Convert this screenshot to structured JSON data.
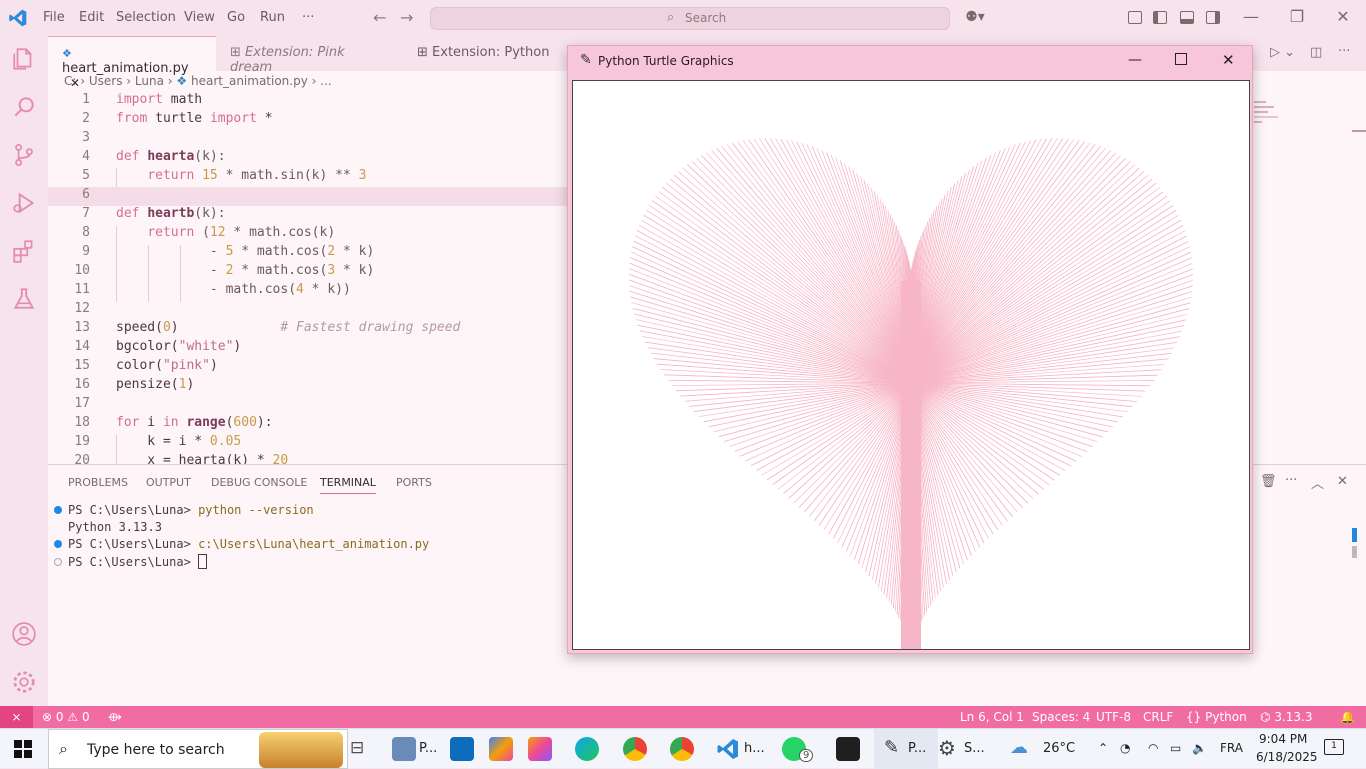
{
  "menu": [
    "File",
    "Edit",
    "Selection",
    "View",
    "Go",
    "Run",
    "···"
  ],
  "search": {
    "placeholder": "Search"
  },
  "tabs": [
    {
      "label": "heart_animation.py",
      "close": "✕"
    },
    {
      "label": "Extension: Pink dream"
    },
    {
      "label": "Extension: Python"
    }
  ],
  "breadcrumb": [
    "C:",
    "Users",
    "Luna",
    "heart_animation.py",
    "..."
  ],
  "code": [
    {
      "n": "1",
      "t": "import math"
    },
    {
      "n": "2",
      "t": "from turtle import *"
    },
    {
      "n": "3",
      "t": ""
    },
    {
      "n": "4",
      "t": "def hearta(k):"
    },
    {
      "n": "5",
      "t": "    return 15 * math.sin(k) ** 3"
    },
    {
      "n": "6",
      "t": ""
    },
    {
      "n": "7",
      "t": "def heartb(k):"
    },
    {
      "n": "8",
      "t": "    return (12 * math.cos(k)"
    },
    {
      "n": "9",
      "t": "            - 5 * math.cos(2 * k)"
    },
    {
      "n": "10",
      "t": "            - 2 * math.cos(3 * k)"
    },
    {
      "n": "11",
      "t": "            - math.cos(4 * k))"
    },
    {
      "n": "12",
      "t": ""
    },
    {
      "n": "13",
      "t": "speed(0)             # Fastest drawing speed"
    },
    {
      "n": "14",
      "t": "bgcolor(\"white\")"
    },
    {
      "n": "15",
      "t": "color(\"pink\")"
    },
    {
      "n": "16",
      "t": "pensize(1)"
    },
    {
      "n": "17",
      "t": ""
    },
    {
      "n": "18",
      "t": "for i in range(600):"
    },
    {
      "n": "19",
      "t": "    k = i * 0.05"
    },
    {
      "n": "20",
      "t": "    x = hearta(k) * 20"
    }
  ],
  "panel_tabs": [
    "PROBLEMS",
    "OUTPUT",
    "DEBUG CONSOLE",
    "TERMINAL",
    "PORTS"
  ],
  "terminal": {
    "prompt": "PS C:\\Users\\Luna>",
    "line1_cmd": "python --version",
    "line2_out": "Python 3.13.3",
    "line3_cmd": "c:\\Users\\Luna\\heart_animation.py"
  },
  "turtle_window": {
    "title": "Python Turtle Graphics",
    "pen_color": "#f7b6c8",
    "background": "#ffffff"
  },
  "statusbar": {
    "errors": "0",
    "warnings": "0",
    "position": "Ln 6, Col 1",
    "spaces": "Spaces: 4",
    "encoding": "UTF-8",
    "eol": "CRLF",
    "language": "Python",
    "version": "3.13.3"
  },
  "taskbar": {
    "search_placeholder": "Type here to search",
    "app_p1": "P...",
    "app_h": "h...",
    "app_p2": "P...",
    "app_s": "S...",
    "whatsapp_badge": "9",
    "temperature": "26°C",
    "lang": "FRA",
    "time": "9:04 PM",
    "date": "6/18/2025",
    "notif_count": "1"
  },
  "colors": {
    "accent": "#f06ca2",
    "keyword": "#d86c96",
    "window_bg": "#f7e3ec"
  }
}
